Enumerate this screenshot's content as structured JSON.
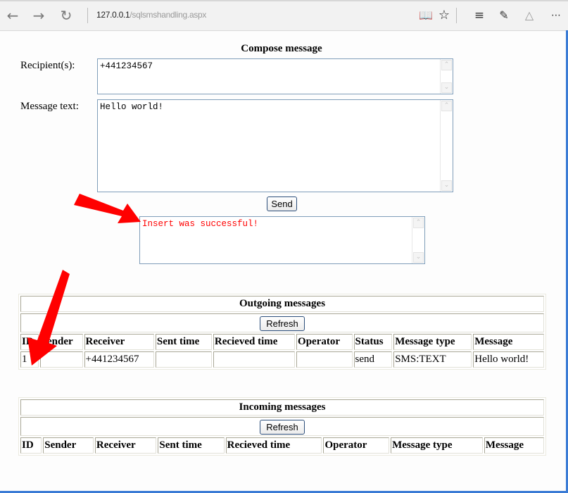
{
  "browser": {
    "url_host": "127.0.0.1",
    "url_path": "/sqlsmshandling.aspx",
    "icons": [
      "back-icon",
      "forward-icon",
      "refresh-icon",
      "reading-view-icon",
      "favorite-star-icon",
      "hub-icon",
      "web-note-icon",
      "share-icon",
      "more-icon"
    ]
  },
  "compose": {
    "title": "Compose message",
    "recipients_label": "Recipient(s):",
    "recipients_value": "+441234567",
    "message_label": "Message text:",
    "message_value": "Hello world!",
    "send_label": "Send",
    "result_text": "Insert was successful!",
    "result_color": "#ff0000"
  },
  "outgoing": {
    "title": "Outgoing messages",
    "refresh_label": "Refresh",
    "columns": [
      "ID",
      "Sender",
      "Receiver",
      "Sent time",
      "Recieved time",
      "Operator",
      "Status",
      "Message type",
      "Message"
    ],
    "rows": [
      [
        "1",
        "",
        "+441234567",
        "",
        "",
        "",
        "send",
        "SMS:TEXT",
        "Hello world!"
      ]
    ]
  },
  "incoming": {
    "title": "Incoming messages",
    "refresh_label": "Refresh",
    "columns": [
      "ID",
      "Sender",
      "Receiver",
      "Sent time",
      "Recieved time",
      "Operator",
      "Message type",
      "Message"
    ],
    "rows": []
  },
  "annotations": {
    "arrow_color": "#ff0000"
  }
}
